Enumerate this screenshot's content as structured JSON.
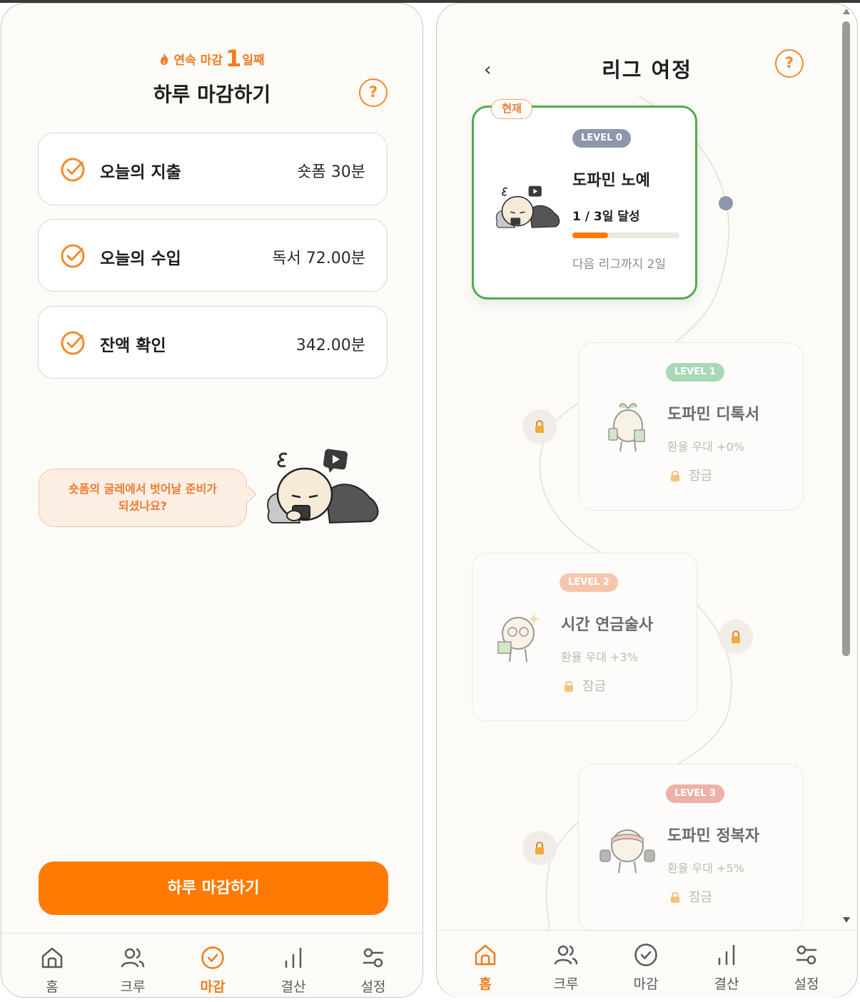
{
  "colors": {
    "accent": "#ff7a00",
    "current_border": "#4cae4c",
    "level0": "#8e96ab",
    "level1": "#a8d8b6",
    "level2": "#f5c6ad",
    "level3": "#eeb1a8"
  },
  "close_screen": {
    "streak": {
      "prefix": "연속 마감",
      "count": "1",
      "suffix": "일째"
    },
    "title": "하루 마감하기",
    "help": "?",
    "rows": [
      {
        "label": "오늘의 지출",
        "value": "숏폼 30분"
      },
      {
        "label": "오늘의 수입",
        "value": "독서 72.00분"
      },
      {
        "label": "잔액 확인",
        "value": "342.00분"
      }
    ],
    "bubble": {
      "line1": "숏폼의 굴레에서 벗어날 준비가",
      "line2": "되셨나요?"
    },
    "cta": "하루 마감하기",
    "active_tab": "마감"
  },
  "league_screen": {
    "back": "‹",
    "title": "리그 여정",
    "help": "?",
    "current_badge": "현재",
    "levels": [
      {
        "pill": "LEVEL 0",
        "name": "도파민 노예",
        "progress_text": "1 / 3일 달성",
        "progress": 0.33,
        "next": "다음 리그까지 2일"
      },
      {
        "pill": "LEVEL 1",
        "name": "도파민 디톡서",
        "rate": "환율 우대 +0%",
        "lock": "잠금"
      },
      {
        "pill": "LEVEL 2",
        "name": "시간 연금술사",
        "rate": "환율 우대 +3%",
        "lock": "잠금"
      },
      {
        "pill": "LEVEL 3",
        "name": "도파민 정복자",
        "rate": "환율 우대 +5%",
        "lock": "잠금"
      }
    ],
    "active_tab": "홈"
  },
  "tabs": [
    {
      "label": "홈",
      "icon": "home-icon"
    },
    {
      "label": "크루",
      "icon": "people-icon"
    },
    {
      "label": "마감",
      "icon": "check-circle-icon"
    },
    {
      "label": "결산",
      "icon": "bar-chart-icon"
    },
    {
      "label": "설정",
      "icon": "settings-sliders-icon"
    }
  ]
}
